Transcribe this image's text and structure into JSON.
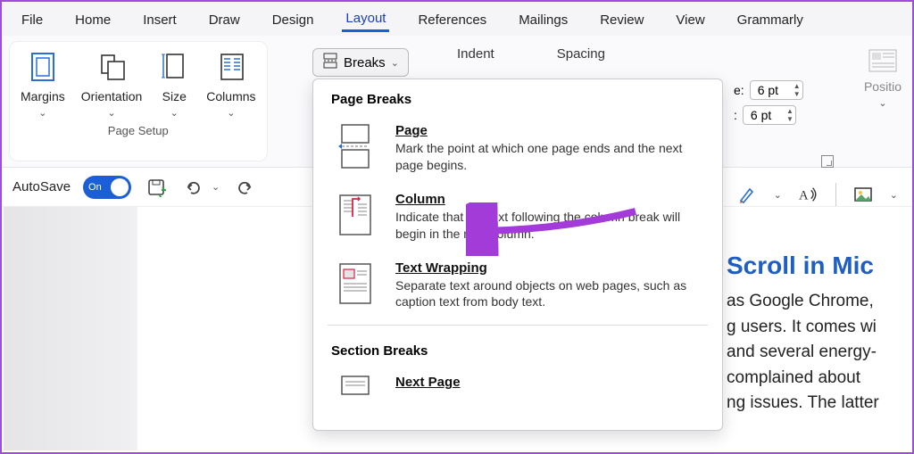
{
  "ribbon_tabs": {
    "file": "File",
    "home": "Home",
    "insert": "Insert",
    "draw": "Draw",
    "design": "Design",
    "layout": "Layout",
    "references": "References",
    "mailings": "Mailings",
    "review": "Review",
    "view": "View",
    "grammarly": "Grammarly"
  },
  "page_setup": {
    "margins": "Margins",
    "orientation": "Orientation",
    "size": "Size",
    "columns": "Columns",
    "group_label": "Page Setup",
    "breaks_label": "Breaks"
  },
  "paragraph_group": {
    "indent": "Indent",
    "spacing": "Spacing",
    "before_label": "e:",
    "after_label": ":",
    "before_value": "6 pt",
    "after_value": "6 pt"
  },
  "arrange": {
    "position_label": "Positio"
  },
  "autosave": {
    "label": "AutoSave",
    "state": "On"
  },
  "breaks_dropdown": {
    "section1": "Page Breaks",
    "page_t": "Page",
    "page_d": "Mark the point at which one page ends and the next page begins.",
    "column_t": "Column",
    "column_d": "Indicate that the text following the column break will begin in the next column.",
    "wrap_t": "Text Wrapping",
    "wrap_d": "Separate text around objects on web pages, such as caption text from body text.",
    "section2": "Section Breaks",
    "next_t": "Next Page"
  },
  "doc": {
    "title": "Scroll in Mic",
    "l1": "as Google Chrome,",
    "l2": "g users. It comes wi",
    "l3": "and several energy-",
    "l4": "complained about",
    "l5": "ng issues. The latter"
  }
}
